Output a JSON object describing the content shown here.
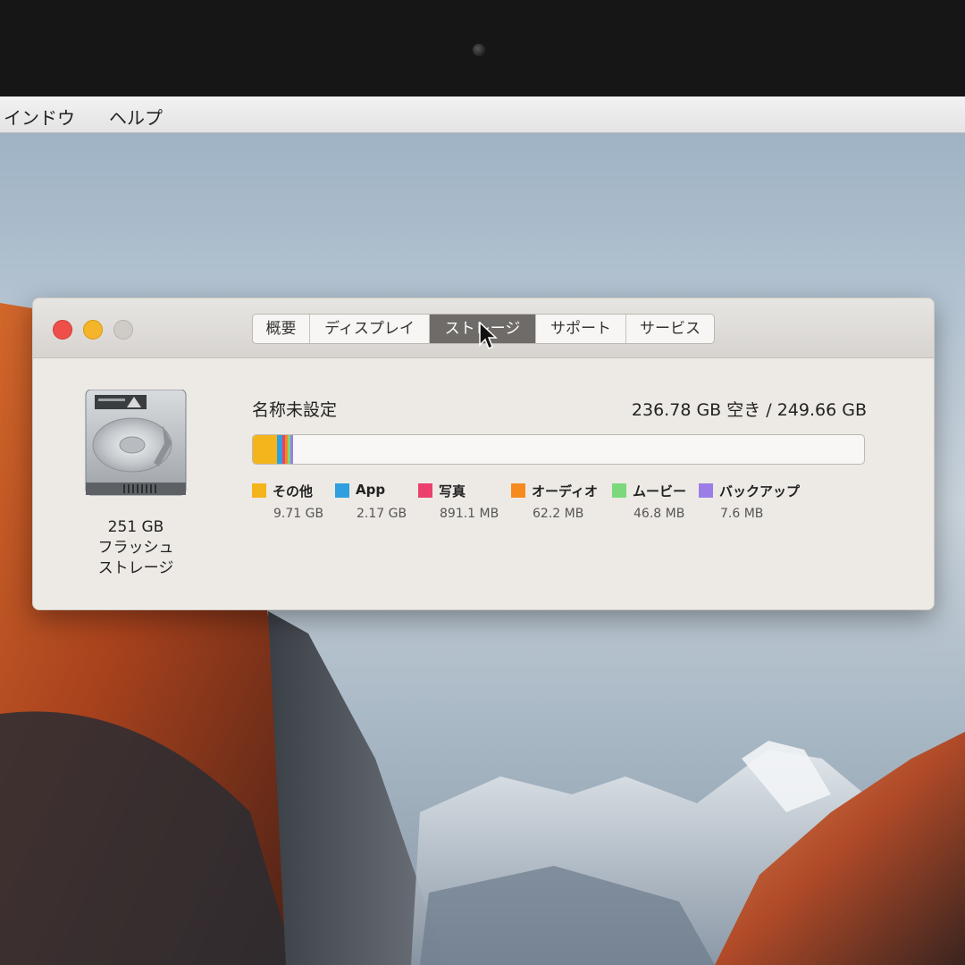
{
  "menubar": {
    "items": [
      "インドウ",
      "ヘルプ"
    ]
  },
  "window": {
    "tabs": [
      "概要",
      "ディスプレイ",
      "ストレージ",
      "サポート",
      "サービス"
    ],
    "active_tab_index": 2
  },
  "disk": {
    "size": "251 GB",
    "type_line1": "フラッシュ",
    "type_line2": "ストレージ"
  },
  "volume": {
    "name": "名称未設定",
    "free_text": "236.78 GB 空き / 249.66 GB"
  },
  "chart_data": {
    "type": "bar",
    "stacked": true,
    "total_gb": 249.66,
    "free_gb": 236.78,
    "categories": [
      "その他",
      "App",
      "写真",
      "オーディオ",
      "ムービー",
      "バックアップ"
    ],
    "values_gb": [
      9.71,
      2.17,
      0.8911,
      0.0622,
      0.0468,
      0.0076
    ],
    "value_labels": [
      "9.71 GB",
      "2.17 GB",
      "891.1 MB",
      "62.2 MB",
      "46.8 MB",
      "7.6 MB"
    ],
    "colors": [
      "#f4b41c",
      "#2f9fe0",
      "#ec3f6e",
      "#f68a1e",
      "#7bd97b",
      "#9b7de8"
    ]
  }
}
